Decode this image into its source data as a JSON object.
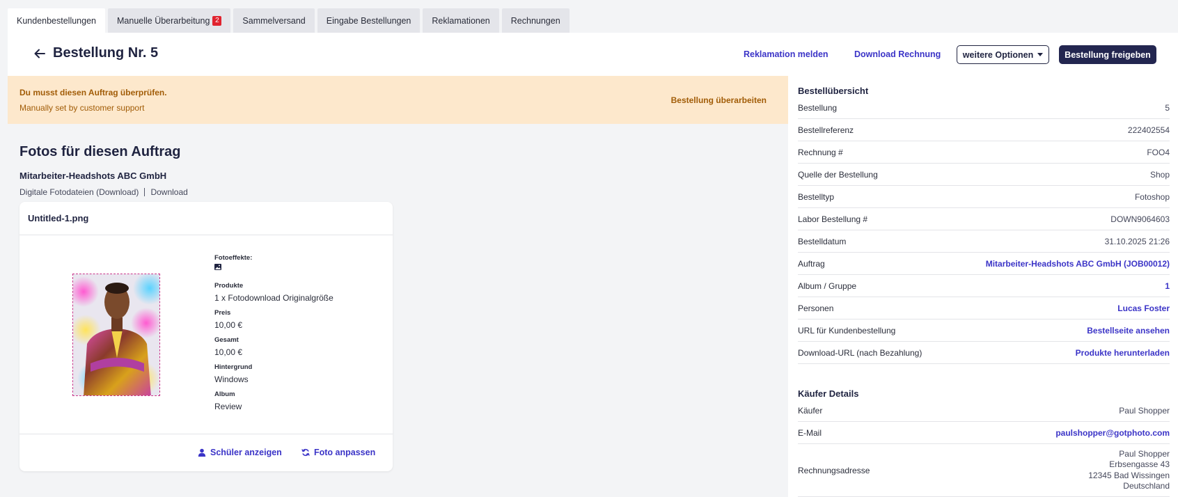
{
  "tabs": [
    {
      "label": "Kundenbestellungen"
    },
    {
      "label": "Manuelle Überarbeitung",
      "badge": "2"
    },
    {
      "label": "Sammelversand"
    },
    {
      "label": "Eingabe Bestellungen"
    },
    {
      "label": "Reklamationen"
    },
    {
      "label": "Rechnungen"
    }
  ],
  "header": {
    "title": "Bestellung Nr. 5",
    "link_complaint": "Reklamation melden",
    "link_invoice": "Download Rechnung",
    "options_label": "weitere Optionen",
    "release_label": "Bestellung freigeben"
  },
  "alert": {
    "title": "Du musst diesen Auftrag überprüfen.",
    "subtitle": "Manually set by customer support",
    "action": "Bestellung überarbeiten"
  },
  "photos": {
    "title": "Fotos für diesen Auftrag",
    "job_name": "Mitarbeiter-Headshots ABC GmbH",
    "product_type": "Digitale Fotodateien (Download)",
    "delivery": "Download",
    "card": {
      "filename": "Untitled-1.png",
      "effects_label": "Fotoeffekte:",
      "products_label": "Produkte",
      "products_value": "1 x Fotodownload Originalgröße",
      "price_label": "Preis",
      "price_value": "10,00 €",
      "total_label": "Gesamt",
      "total_value": "10,00 €",
      "background_label": "Hintergrund",
      "background_value": "Windows",
      "album_label": "Album",
      "album_value": "Review",
      "show_student": "Schüler anzeigen",
      "adjust_photo": "Foto anpassen"
    }
  },
  "summary": {
    "title": "Bestellübersicht",
    "rows": [
      {
        "label": "Bestellung",
        "value": "5"
      },
      {
        "label": "Bestellreferenz",
        "value": "222402554"
      },
      {
        "label": "Rechnung #",
        "value": "FOO4"
      },
      {
        "label": "Quelle der Bestellung",
        "value": "Shop"
      },
      {
        "label": "Bestelltyp",
        "value": "Fotoshop"
      },
      {
        "label": "Labor Bestellung #",
        "value": "DOWN9064603"
      },
      {
        "label": "Bestelldatum",
        "value": "31.10.2025 21:26"
      },
      {
        "label": "Auftrag",
        "value": "Mitarbeiter-Headshots ABC GmbH (JOB00012)"
      },
      {
        "label": "Album / Gruppe",
        "value": "1"
      },
      {
        "label": "Personen",
        "value": "Lucas Foster"
      },
      {
        "label": "URL für Kundenbestellung",
        "value": "Bestellseite ansehen"
      },
      {
        "label": "Download-URL (nach Bezahlung)",
        "value": "Produkte herunterladen"
      }
    ]
  },
  "buyer": {
    "title": "Käufer Details",
    "buyer_label": "Käufer",
    "buyer_value": "Paul Shopper",
    "email_label": "E-Mail",
    "email_value": "paulshopper@gotphoto.com",
    "address_label": "Rechnungsadresse",
    "address_lines": [
      "Paul Shopper",
      "Erbsengasse 43",
      "12345 Bad Wissingen",
      "Deutschland"
    ]
  }
}
